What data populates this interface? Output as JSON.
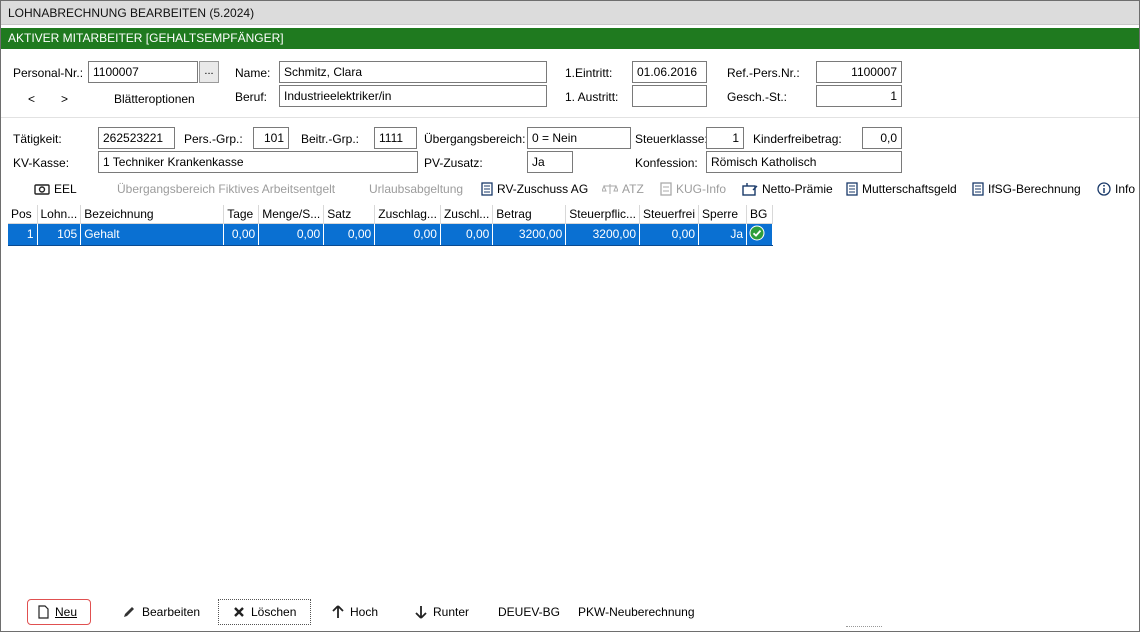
{
  "window": {
    "title": "LOHNABRECHNUNG BEARBEITEN (5.2024)",
    "status_bar": "AKTIVER MITARBEITER [GEHALTSEMPFÄNGER]"
  },
  "employee": {
    "personal_nr_label": "Personal-Nr.:",
    "personal_nr": "1100007",
    "browse_label": "...",
    "prev_label": "<",
    "next_label": ">",
    "page_options_label": "Blätteroptionen",
    "name_label": "Name:",
    "name": "Schmitz, Clara",
    "beruf_label": "Beruf:",
    "beruf": "Industrieelektriker/in",
    "eintritt_label": "1.Eintritt:",
    "eintritt": "01.06.2016",
    "austritt_label": "1. Austritt:",
    "austritt": "",
    "ref_label": "Ref.-Pers.Nr.:",
    "ref": "1100007",
    "gesch_label": "Gesch.-St.:",
    "gesch": "1"
  },
  "details": {
    "taetigkeit_label": "Tätigkeit:",
    "taetigkeit": "262523221",
    "persgrp_label": "Pers.-Grp.:",
    "persgrp": "101",
    "beitrgrp_label": "Beitr.-Grp.:",
    "beitrgrp": "1111",
    "uebergang_label": "Übergangsbereich:",
    "uebergang": "0 = Nein",
    "steuerklasse_label": "Steuerklasse:",
    "steuerklasse": "1",
    "kinderfreibetrag_label": "Kinderfreibetrag:",
    "kinderfreibetrag": "0,0",
    "kvkasse_label": "KV-Kasse:",
    "kvkasse": "1 Techniker Krankenkasse",
    "pvzusatz_label": "PV-Zusatz:",
    "pvzusatz": "Ja",
    "konfession_label": "Konfession:",
    "konfession": "Römisch Katholisch"
  },
  "toolbar": {
    "eel": "EEL",
    "uebergang_fiktiv": "Übergangsbereich Fiktives Arbeitsentgelt",
    "urlaubsabgeltung": "Urlaubsabgeltung",
    "rv_zuschuss": "RV-Zuschuss AG",
    "atz": "ATZ",
    "kug_info": "KUG-Info",
    "netto_praemie": "Netto-Prämie",
    "mutterschaftsgeld": "Mutterschaftsgeld",
    "ifsg": "IfSG-Berechnung",
    "info": "Info"
  },
  "table": {
    "columns": [
      "Pos",
      "Lohn...",
      "Bezeichnung",
      "Tage",
      "Menge/S...",
      "Satz",
      "Zuschlag...",
      "Zuschl...",
      "Betrag",
      "Steuerpflic...",
      "Steuerfrei",
      "Sperre",
      "BG"
    ],
    "rows": [
      {
        "pos": "1",
        "lohn": "105",
        "bezeichnung": "Gehalt",
        "tage": "0,00",
        "menge": "0,00",
        "satz": "0,00",
        "zuschlag": "0,00",
        "zuschl": "0,00",
        "betrag": "3200,00",
        "steuerpflichtig": "3200,00",
        "steuerfrei": "0,00",
        "sperre": "Ja",
        "bg": "check-circle-icon"
      }
    ]
  },
  "bottom": {
    "neu": "Neu",
    "bearbeiten": "Bearbeiten",
    "loeschen": "Löschen",
    "hoch": "Hoch",
    "runter": "Runter",
    "deuev": "DEUEV-BG",
    "pkw": "PKW-Neuberechnung"
  },
  "colors": {
    "green_bar": "#1f7a1f",
    "selection": "#0a70d2",
    "highlight_outline": "#e05050"
  }
}
